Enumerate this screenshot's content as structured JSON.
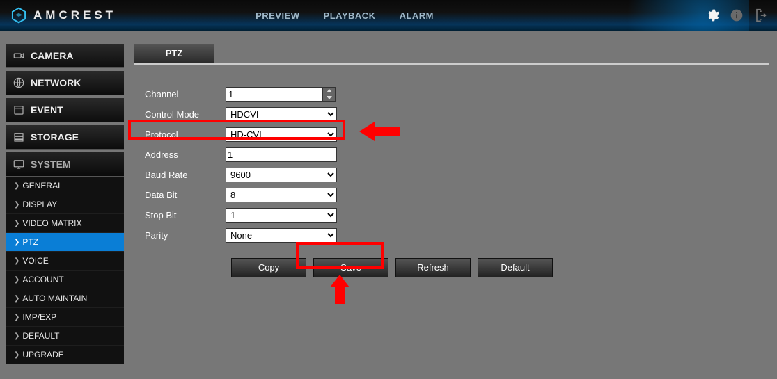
{
  "brand": "AMCREST",
  "nav": {
    "preview": "PREVIEW",
    "playback": "PLAYBACK",
    "alarm": "ALARM"
  },
  "sidebar": {
    "camera": "CAMERA",
    "network": "NETWORK",
    "event": "EVENT",
    "storage": "STORAGE",
    "system": "SYSTEM",
    "system_items": [
      {
        "label": "GENERAL"
      },
      {
        "label": "DISPLAY"
      },
      {
        "label": "VIDEO MATRIX"
      },
      {
        "label": "PTZ"
      },
      {
        "label": "VOICE"
      },
      {
        "label": "ACCOUNT"
      },
      {
        "label": "AUTO MAINTAIN"
      },
      {
        "label": "IMP/EXP"
      },
      {
        "label": "DEFAULT"
      },
      {
        "label": "UPGRADE"
      }
    ]
  },
  "tab": {
    "label": "PTZ"
  },
  "form": {
    "channel_label": "Channel",
    "channel_value": "1",
    "control_mode_label": "Control Mode",
    "control_mode_value": "HDCVI",
    "protocol_label": "Protocol",
    "protocol_value": "HD-CVI",
    "address_label": "Address",
    "address_value": "1",
    "baud_label": "Baud Rate",
    "baud_value": "9600",
    "databit_label": "Data Bit",
    "databit_value": "8",
    "stopbit_label": "Stop Bit",
    "stopbit_value": "1",
    "parity_label": "Parity",
    "parity_value": "None"
  },
  "buttons": {
    "copy": "Copy",
    "save": "Save",
    "refresh": "Refresh",
    "default": "Default"
  }
}
